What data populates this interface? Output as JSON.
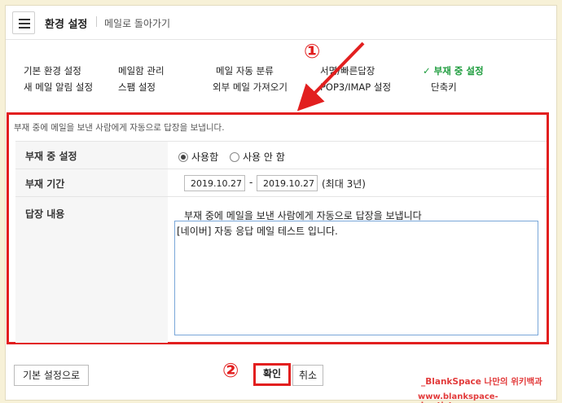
{
  "header": {
    "title": "환경 설정",
    "back_link": "메일로 돌아가기"
  },
  "nav": {
    "row1": [
      "기본 환경 설정",
      "메일함 관리",
      "메일 자동 분류",
      "서명/빠른답장",
      "부재 중 설정"
    ],
    "row2": [
      "새 메일 알림 설정",
      "스팸 설정",
      "외부 메일 가져오기",
      "POP3/IMAP 설정",
      "단축키"
    ],
    "active": "부재 중 설정"
  },
  "annotations": {
    "marker1": "①",
    "marker2": "②"
  },
  "section": {
    "description": "부재 중에 메일을 보낸 사람에게 자동으로 답장을 보냅니다.",
    "away_setting": {
      "label": "부재 중 설정",
      "option_on": "사용함",
      "option_off": "사용 안 함",
      "selected": "사용함"
    },
    "away_period": {
      "label": "부재 기간",
      "start_date": "2019.10.27",
      "dash": "-",
      "end_date": "2019.10.27",
      "max_note": "(최대 3년)"
    },
    "reply_content": {
      "label": "답장 내용",
      "subject": "부재 중에 메일을 보낸 사람에게 자동으로 답장을 보냅니다",
      "body": "[네이버] 자동 응답 메일 테스트 입니다."
    }
  },
  "footer": {
    "reset_button": "기본 설정으로",
    "confirm_button": "확인",
    "cancel_button": "취소"
  },
  "watermark": {
    "line1": "_BlankSpace 나만의 위키백과",
    "line2": "www.blankspace-dev.tistory.com"
  },
  "colors": {
    "accent_green": "#1d9c3d",
    "annotation_red": "#e21f1f",
    "background": "#f7f1d7"
  }
}
